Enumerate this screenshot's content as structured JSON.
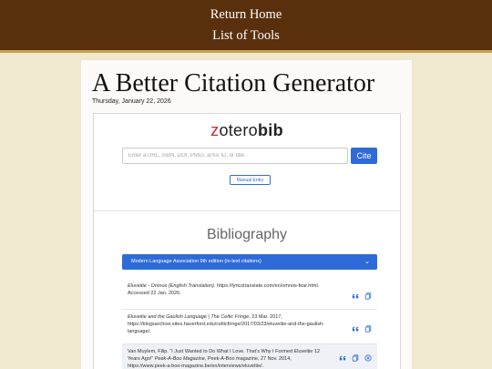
{
  "nav": {
    "return_home": "Return Home",
    "list_of_tools": "List of Tools"
  },
  "page": {
    "title": "A Better Citation Generator",
    "date": "Thursday, January 22, 2026"
  },
  "zbib": {
    "logo_prefix": "zotero",
    "logo_bold": "bib",
    "search_placeholder": "Enter a URL, ISBN, DOI, PMID, arXiv ID, or title",
    "cite_label": "Cite",
    "manual_entry_label": "Manual Entry",
    "bibliography_title": "Bibliography",
    "citation_style": "Modern Language Association 9th edition (in-text citations)"
  },
  "entries": [
    {
      "title": "Eluveitie - Omnos (English Translation)",
      "rest": ". https://lyricstranslate.com/en/omnos-fear.html. Accessed 22 Jan. 2026."
    },
    {
      "title": "Eluveitie and the Gaulish Language | The Celtic Fringe",
      "rest": ". 23 Mar. 2017, https://blogsarchive.sites.haverford.edu/celticfringe/2017/03/23/eluveitie-and-the-gaulish-language/."
    },
    {
      "lead": "Van Muylem, Filip. “I Just Wanted to Do What I Love. That’s Why I Formed Eluveitie 12 Years Ago!” ",
      "title": "Peek-A-Boo Magazine",
      "rest": ", Peek-A-Boo magazine, 27 Nov. 2014, https://www.peek-a-boo-magazine.be/en/interviews/eluveitie/."
    }
  ],
  "colors": {
    "header_bg": "#5a2f0c",
    "accent_line": "#c7a352",
    "page_bg": "#f0e8cf",
    "primary_blue": "#2e6bd8",
    "logo_red": "#cc2936"
  }
}
